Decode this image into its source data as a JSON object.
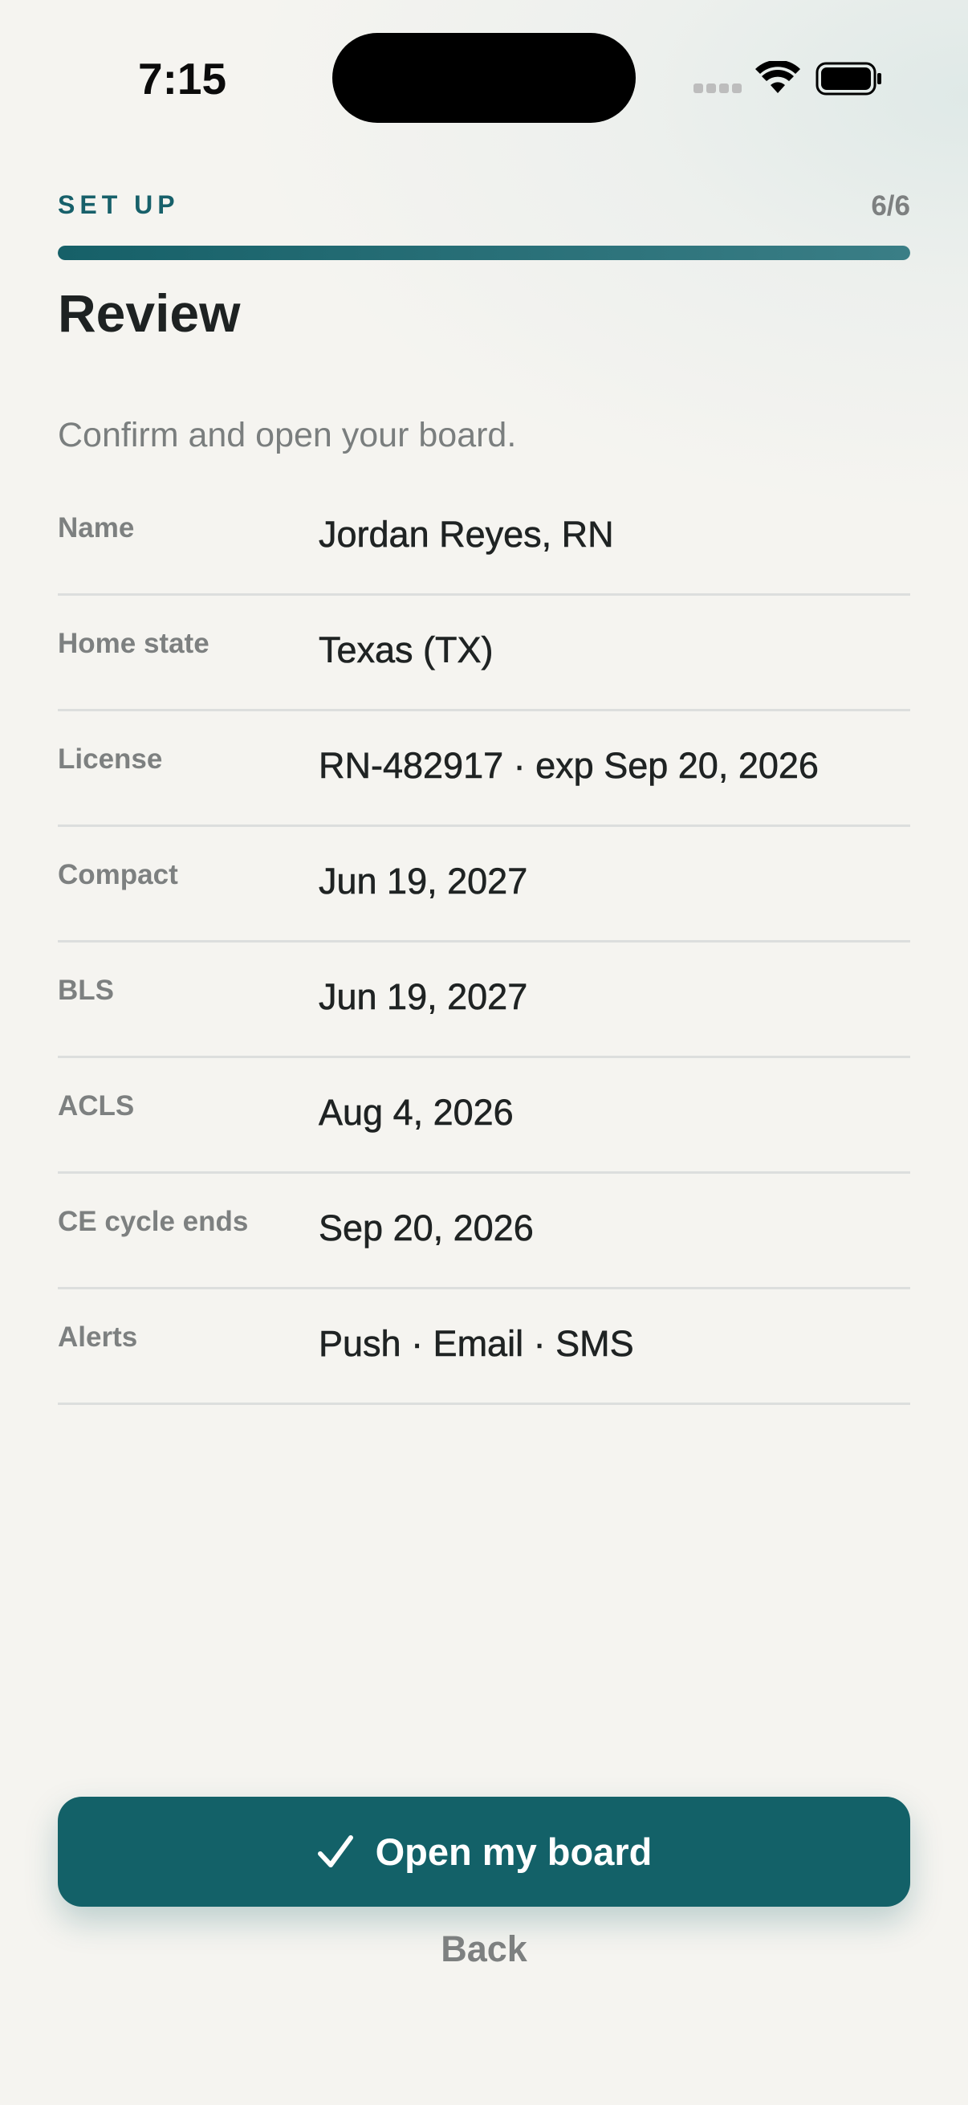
{
  "status_bar": {
    "time": "7:15"
  },
  "header": {
    "eyebrow": "SET UP",
    "step_count": "6/6",
    "progress": 1.0,
    "title": "Review",
    "subtitle": "Confirm and open your board."
  },
  "summary": {
    "rows": [
      {
        "label": "Name",
        "value": "Jordan Reyes, RN"
      },
      {
        "label": "Home state",
        "value": "Texas (TX)"
      },
      {
        "label": "License",
        "value": "RN-482917 · exp Sep 20, 2026"
      },
      {
        "label": "Compact",
        "value": "Jun 19, 2027"
      },
      {
        "label": "BLS",
        "value": "Jun 19, 2027"
      },
      {
        "label": "ACLS",
        "value": "Aug 4, 2026"
      },
      {
        "label": "CE cycle ends",
        "value": "Sep 20, 2026"
      },
      {
        "label": "Alerts",
        "value": "Push · Email · SMS"
      }
    ]
  },
  "actions": {
    "primary_label": "Open my board",
    "primary_icon": "checkmark-icon",
    "back_label": "Back"
  },
  "colors": {
    "accent": "#136168",
    "eyebrow": "#17606a",
    "muted_text": "#7d8080",
    "background": "#f5f4f0"
  }
}
